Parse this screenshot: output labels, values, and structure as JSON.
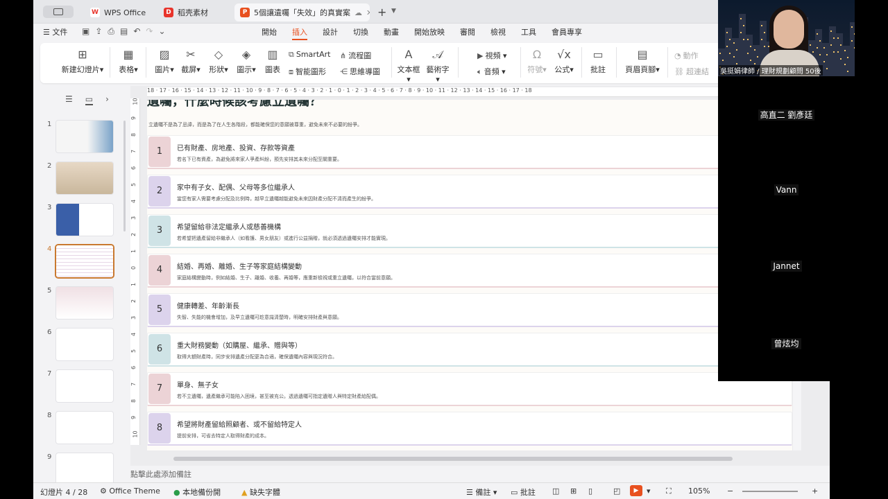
{
  "tabs": [
    {
      "label": "WPS Office",
      "icon": "W",
      "color": "#e8342b"
    },
    {
      "label": "稻壳素材",
      "icon": "D",
      "color": "#e8342b"
    },
    {
      "label": "5個讓遺囑「失效」的真實案",
      "icon": "P",
      "color": "#e8501f"
    }
  ],
  "menu": {
    "file": "文件",
    "tabs": [
      "開始",
      "插入",
      "設計",
      "切換",
      "動畫",
      "開始放映",
      "審閱",
      "檢視",
      "工具",
      "會員專享"
    ],
    "active": "插入"
  },
  "ribbon": {
    "new_slide": "新建幻燈片",
    "table": "表格",
    "picture": "圖片",
    "screenshot": "截屏",
    "shape": "形狀",
    "icon": "圖示",
    "chart": "圖表",
    "smartart": "SmartArt",
    "smart_shape": "智能圖形",
    "flowchart": "流程圖",
    "mindmap": "思維導圖",
    "textbox": "文本框",
    "wordart": "藝術字",
    "video": "視頻",
    "audio": "音頻",
    "symbol": "符號",
    "formula": "公式",
    "comment": "批註",
    "header_footer": "頁眉頁腳",
    "action": "動作",
    "hyperlink": "超連結"
  },
  "thumbnails": [
    "1",
    "2",
    "3",
    "4",
    "5",
    "6",
    "7",
    "8",
    "9"
  ],
  "ruler": {
    "h": [
      "18",
      "17",
      "16",
      "15",
      "14",
      "13",
      "12",
      "11",
      "10",
      "9",
      "8",
      "7",
      "6",
      "5",
      "4",
      "3",
      "2",
      "1",
      "0",
      "1",
      "2",
      "3",
      "4",
      "5",
      "6",
      "7",
      "8",
      "9",
      "10",
      "11",
      "12",
      "13",
      "14",
      "15",
      "16",
      "17",
      "18"
    ],
    "v": [
      "10",
      "9",
      "8",
      "7",
      "6",
      "5",
      "4",
      "3",
      "2",
      "1",
      "0",
      "1",
      "2",
      "3",
      "4",
      "5",
      "6",
      "7",
      "8",
      "9",
      "10"
    ]
  },
  "slide": {
    "title": "遺囑，什麼時候該考慮立遺囑？",
    "intro": "立遺囑不是為了忌諱，而是為了在人生各階段，都能確保您的意願被尊重，避免未來不必要的紛爭。",
    "items": [
      {
        "num": "1",
        "title": "已有財產、房地產、投資、存款等資產",
        "desc": "若名下已有資產，為避免將來家人爭產糾紛，預先安排其未來分配至關重要。",
        "color": "#ecd3d6"
      },
      {
        "num": "2",
        "title": "家中有子女、配偶、父母等多位繼承人",
        "desc": "當您有家人需要考慮分配及比例時，越早立遺囑越能避免未來因財產分配不清而產生的紛爭。",
        "color": "#dcd3ec"
      },
      {
        "num": "3",
        "title": "希望留給非法定繼承人或慈善機構",
        "desc": "若希望把遺產留給非繼承人（如看護、男女朋友）或進行公益捐贈，就必須透過遺囑安排才能實現。",
        "color": "#cfe3e6"
      },
      {
        "num": "4",
        "title": "結婚、再婚、離婚、生子等家庭結構變動",
        "desc": "家庭結構變動時，例如結婚、生子、離婚、收養、再婚等，應重新檢視或重立遺囑，以符合當前意願。",
        "color": "#ecd3d6"
      },
      {
        "num": "5",
        "title": "健康轉差、年齡漸長",
        "desc": "失智、失能的機會增加，及早立遺囑可趁意識清楚時，明確安排財產與意願。",
        "color": "#dcd3ec"
      },
      {
        "num": "6",
        "title": "重大財務變動（如購屋、繼承、贈與等）",
        "desc": "取得大額財產時，同步安排遺產分配更為合適，確保遺囑內容與現況符合。",
        "color": "#cfe3e6"
      },
      {
        "num": "7",
        "title": "單身、無子女",
        "desc": "若不立遺囑，遺產繼承可能陷入困境，甚至被充公。透過遺囑可指定遺贈人與特定財產給配偶。",
        "color": "#ecd3d6"
      },
      {
        "num": "8",
        "title": "希望將財產留給照顧者、或不留給特定人",
        "desc": "提前安排，可省去特定人取得財產的成本。",
        "color": "#dcd3ec"
      }
    ]
  },
  "notes": "點擊此處添加備註",
  "status": {
    "slide_count": "幻燈片 4 / 28",
    "theme": "Office Theme",
    "backup": "本地備份開",
    "missing_font": "缺失字體",
    "notes": "備註",
    "comments": "批註",
    "zoom": "105%"
  },
  "video": {
    "host_name": "吳挺娟律師 / 理財規劃顧問 50後",
    "participants": [
      "高直二 劉彥廷",
      "Vann",
      "Jannet",
      "曾炫均"
    ]
  }
}
